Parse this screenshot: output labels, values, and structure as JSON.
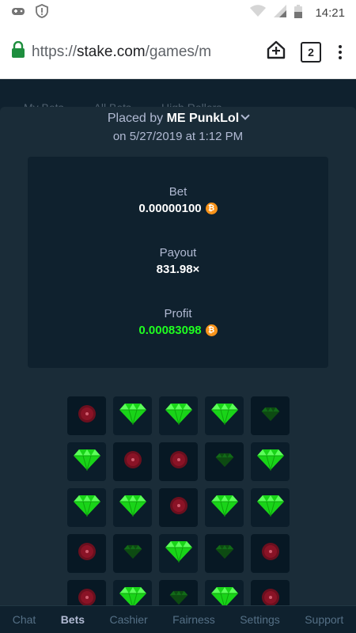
{
  "status_bar": {
    "time": "14:21",
    "icons": [
      "game-controller-icon",
      "alert-icon",
      "wifi-icon",
      "signal-icon",
      "battery-icon"
    ]
  },
  "browser": {
    "url_prefix": "https://",
    "url_host": "stake.com",
    "url_path": "/games/m",
    "tab_count": "2",
    "icons": [
      "lock-icon",
      "home-add-icon",
      "tabs-icon",
      "menu-icon"
    ]
  },
  "background_tabs": [
    "My Bets",
    "All Bets",
    "High Rollers"
  ],
  "bet": {
    "placed_by_prefix": "Placed by",
    "username": "ME PunkLol",
    "date_line": "on 5/27/2019 at 1:12 PM",
    "bet_label": "Bet",
    "bet_value": "0.00000100",
    "payout_label": "Payout",
    "payout_value": "831.98×",
    "profit_label": "Profit",
    "profit_value": "0.00083098",
    "currency_icon": "bitcoin-icon",
    "profit_color": "#1fff20"
  },
  "grid": {
    "rows": [
      [
        "mine",
        "gem",
        "gem",
        "gem",
        "gem-dim"
      ],
      [
        "gem",
        "mine",
        "mine",
        "gem-dim",
        "gem"
      ],
      [
        "gem",
        "gem",
        "mine",
        "gem",
        "gem"
      ],
      [
        "mine",
        "gem-dim",
        "gem",
        "gem-dim",
        "mine"
      ],
      [
        "mine",
        "gem",
        "gem-dim",
        "gem",
        "mine"
      ]
    ]
  },
  "nav": {
    "items": [
      {
        "label": "Chat",
        "active": false
      },
      {
        "label": "Bets",
        "active": true
      },
      {
        "label": "Cashier",
        "active": false
      },
      {
        "label": "Fairness",
        "active": false
      },
      {
        "label": "Settings",
        "active": false
      },
      {
        "label": "Support",
        "active": false
      }
    ]
  }
}
